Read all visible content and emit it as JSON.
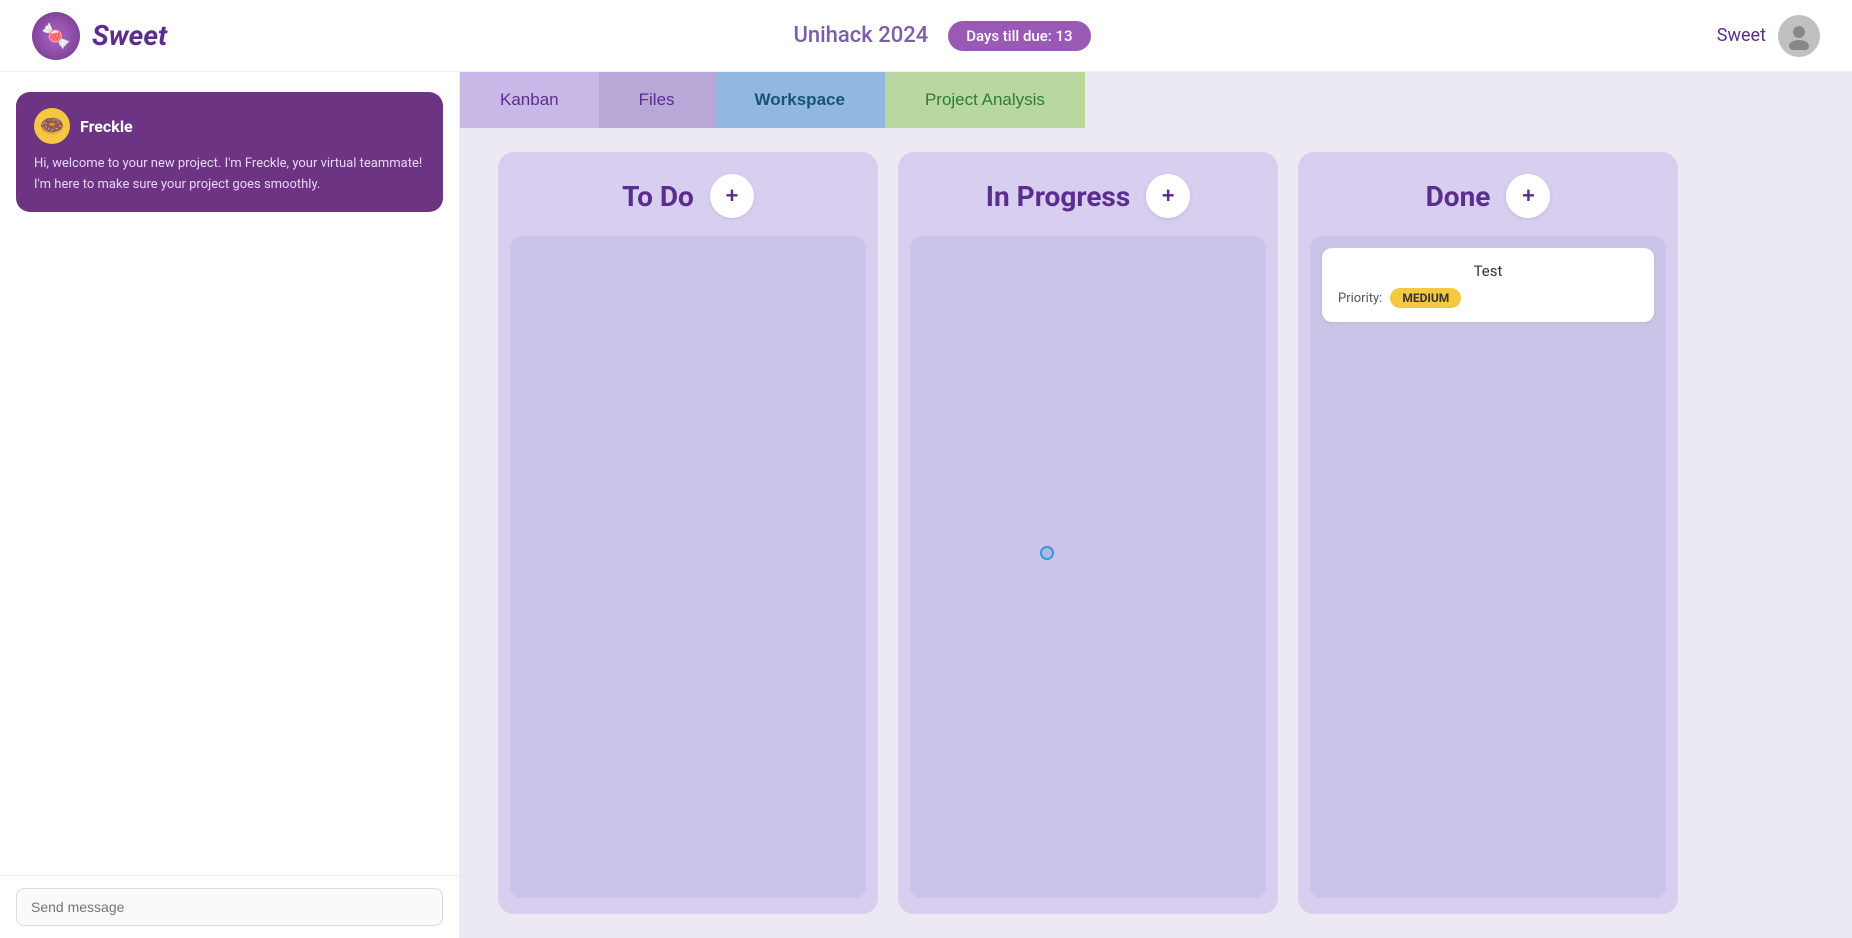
{
  "header": {
    "logo_text": "Sweet",
    "logo_emoji": "🍬",
    "project_title": "Unihack 2024",
    "days_badge": "Days till due: 13",
    "user_name": "Sweet"
  },
  "tabs": [
    {
      "id": "kanban",
      "label": "Kanban",
      "active": false
    },
    {
      "id": "files",
      "label": "Files",
      "active": false
    },
    {
      "id": "workspace",
      "label": "Workspace",
      "active": true
    },
    {
      "id": "project-analysis",
      "label": "Project Analysis",
      "active": false
    }
  ],
  "chat": {
    "bot_name": "Freckle",
    "bot_emoji": "🍩",
    "bot_message": "Hi, welcome to your new project. I'm Freckle, your virtual teammate! I'm here to make sure your project goes smoothly.",
    "input_placeholder": "Send message"
  },
  "kanban": {
    "columns": [
      {
        "id": "todo",
        "title": "To Do",
        "cards": []
      },
      {
        "id": "in-progress",
        "title": "In Progress",
        "cards": []
      },
      {
        "id": "done",
        "title": "Done",
        "cards": [
          {
            "title": "Test",
            "priority_label": "Priority:",
            "priority": "MEDIUM",
            "priority_level": "medium"
          }
        ]
      }
    ]
  }
}
